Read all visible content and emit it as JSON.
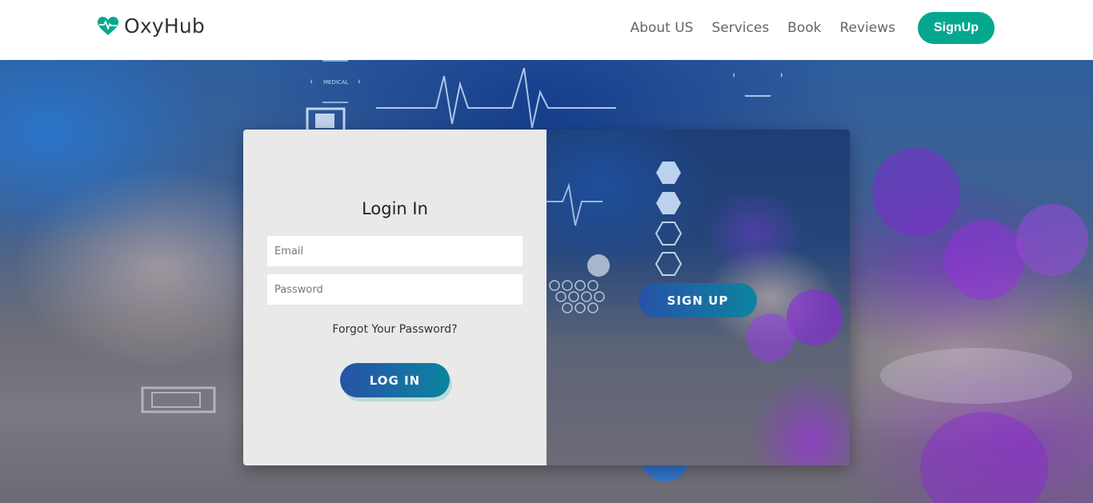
{
  "brand": {
    "name": "OxyHub",
    "icon": "heart-pulse-icon",
    "accent": "#05a88f"
  },
  "nav": {
    "links": [
      "About US",
      "Services",
      "Book",
      "Reviews"
    ],
    "signup_label": "SignUp"
  },
  "hero": {
    "hex_label": "MEDICAL"
  },
  "login": {
    "title": "Login In",
    "email_placeholder": "Email",
    "password_placeholder": "Password",
    "forgot_label": "Forgot Your Password?",
    "button_label": "LOG IN"
  },
  "signup_panel": {
    "button_label": "SIGN UP"
  },
  "colors": {
    "button_gradient_start": "#2752a8",
    "button_gradient_end": "#0c84a0",
    "login_panel_bg": "#e9e9e9"
  }
}
